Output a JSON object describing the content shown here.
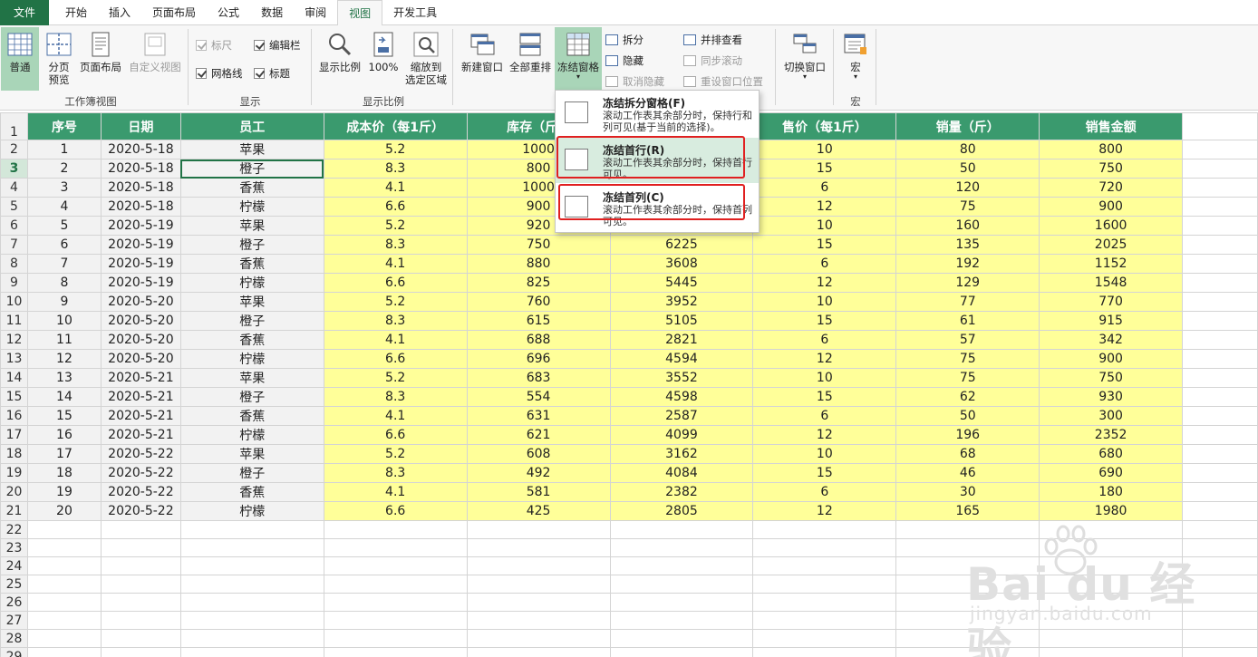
{
  "tabs": [
    {
      "label": "文件"
    },
    {
      "label": "开始"
    },
    {
      "label": "插入"
    },
    {
      "label": "页面布局"
    },
    {
      "label": "公式"
    },
    {
      "label": "数据"
    },
    {
      "label": "审阅"
    },
    {
      "label": "视图"
    },
    {
      "label": "开发工具"
    }
  ],
  "ribbon": {
    "workbook_views": {
      "normal": "普通",
      "page_break_1": "分页",
      "page_break_2": "预览",
      "page_layout": "页面布局",
      "custom_view": "自定义视图",
      "group_label": "工作簿视图"
    },
    "show": {
      "ruler": "标尺",
      "formula_bar": "编辑栏",
      "gridlines": "网格线",
      "headings": "标题",
      "group_label": "显示"
    },
    "zoom": {
      "zoom": "显示比例",
      "hundred": "100%",
      "zoom_selection_1": "缩放到",
      "zoom_selection_2": "选定区域",
      "group_label": "显示比例"
    },
    "window": {
      "new_window": "新建窗口",
      "arrange_all": "全部重排",
      "freeze_panes": "冻结窗格",
      "split": "拆分",
      "hide": "隐藏",
      "unhide": "取消隐藏",
      "side_by_side": "并排查看",
      "sync_scroll": "同步滚动",
      "reset_position": "重设窗口位置",
      "switch_windows": "切换窗口",
      "group_label": "窗口"
    },
    "macros": {
      "macros": "宏",
      "group_label": "宏"
    }
  },
  "dropdown": {
    "items": [
      {
        "title": "冻结拆分窗格(F)",
        "desc": "滚动工作表其余部分时，保持行和列可见(基于当前的选择)。"
      },
      {
        "title": "冻结首行(R)",
        "desc": "滚动工作表其余部分时，保持首行可见。"
      },
      {
        "title": "冻结首列(C)",
        "desc": "滚动工作表其余部分时，保持首列可见。"
      }
    ]
  },
  "sheet": {
    "headers": [
      "序号",
      "日期",
      "员工",
      "成本价（每1斤）",
      "库存（斤）",
      "",
      "售价（每1斤）",
      "销量（斤）",
      "销售金额"
    ],
    "rows": [
      [
        "1",
        "2020-5-18",
        "苹果",
        "5.2",
        "1000",
        "",
        "10",
        "80",
        "800"
      ],
      [
        "2",
        "2020-5-18",
        "橙子",
        "8.3",
        "800",
        "",
        "15",
        "50",
        "750"
      ],
      [
        "3",
        "2020-5-18",
        "香蕉",
        "4.1",
        "1000",
        "",
        "6",
        "120",
        "720"
      ],
      [
        "4",
        "2020-5-18",
        "柠檬",
        "6.6",
        "900",
        "",
        "12",
        "75",
        "900"
      ],
      [
        "5",
        "2020-5-19",
        "苹果",
        "5.2",
        "920",
        "",
        "10",
        "160",
        "1600"
      ],
      [
        "6",
        "2020-5-19",
        "橙子",
        "8.3",
        "750",
        "6225",
        "15",
        "135",
        "2025"
      ],
      [
        "7",
        "2020-5-19",
        "香蕉",
        "4.1",
        "880",
        "3608",
        "6",
        "192",
        "1152"
      ],
      [
        "8",
        "2020-5-19",
        "柠檬",
        "6.6",
        "825",
        "5445",
        "12",
        "129",
        "1548"
      ],
      [
        "9",
        "2020-5-20",
        "苹果",
        "5.2",
        "760",
        "3952",
        "10",
        "77",
        "770"
      ],
      [
        "10",
        "2020-5-20",
        "橙子",
        "8.3",
        "615",
        "5105",
        "15",
        "61",
        "915"
      ],
      [
        "11",
        "2020-5-20",
        "香蕉",
        "4.1",
        "688",
        "2821",
        "6",
        "57",
        "342"
      ],
      [
        "12",
        "2020-5-20",
        "柠檬",
        "6.6",
        "696",
        "4594",
        "12",
        "75",
        "900"
      ],
      [
        "13",
        "2020-5-21",
        "苹果",
        "5.2",
        "683",
        "3552",
        "10",
        "75",
        "750"
      ],
      [
        "14",
        "2020-5-21",
        "橙子",
        "8.3",
        "554",
        "4598",
        "15",
        "62",
        "930"
      ],
      [
        "15",
        "2020-5-21",
        "香蕉",
        "4.1",
        "631",
        "2587",
        "6",
        "50",
        "300"
      ],
      [
        "16",
        "2020-5-21",
        "柠檬",
        "6.6",
        "621",
        "4099",
        "12",
        "196",
        "2352"
      ],
      [
        "17",
        "2020-5-22",
        "苹果",
        "5.2",
        "608",
        "3162",
        "10",
        "68",
        "680"
      ],
      [
        "18",
        "2020-5-22",
        "橙子",
        "8.3",
        "492",
        "4084",
        "15",
        "46",
        "690"
      ],
      [
        "19",
        "2020-5-22",
        "香蕉",
        "4.1",
        "581",
        "2382",
        "6",
        "30",
        "180"
      ],
      [
        "20",
        "2020-5-22",
        "柠檬",
        "6.6",
        "425",
        "2805",
        "12",
        "165",
        "1980"
      ]
    ],
    "row_numbers": [
      "1",
      "2",
      "3",
      "4",
      "5",
      "6",
      "7",
      "8",
      "9",
      "10",
      "11",
      "12",
      "13",
      "14",
      "15",
      "16",
      "17",
      "18",
      "19",
      "20",
      "21",
      "22",
      "23",
      "24",
      "25",
      "26",
      "27",
      "28",
      "29"
    ]
  },
  "watermark": {
    "brand": "Bai du 经验",
    "url": "jingyan.baidu.com"
  },
  "colors": {
    "accent": "#217346",
    "header_fill": "#3a9a6e",
    "value_fill": "#ffff99",
    "highlight_box": "#e02020"
  }
}
